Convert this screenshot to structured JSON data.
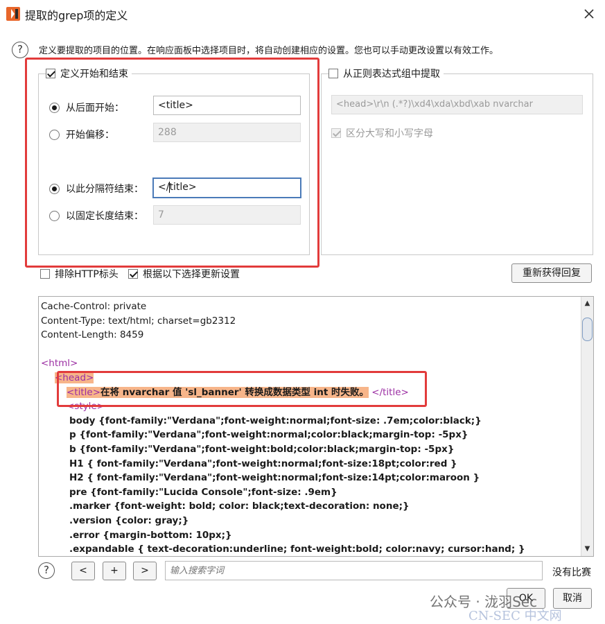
{
  "window": {
    "title": "提取的grep项的定义",
    "close_glyph": "✕"
  },
  "description": "定义要提取的项目的位置。在响应面板中选择项目时，将自动创建相应的设置。您也可以手动更改设置以有效工作。",
  "help_glyph": "?",
  "start_end_group": {
    "legend": "定义开始和结束",
    "checked": true,
    "start_after": {
      "label": "从后面开始：",
      "value": "<title>",
      "selected": true
    },
    "start_offset": {
      "label": "开始偏移：",
      "value": "288",
      "selected": false
    },
    "end_delimiter": {
      "label": "以此分隔符结束：",
      "value_before_caret": "</",
      "value_after_caret": "title>",
      "selected": true
    },
    "end_fixed_length": {
      "label": "以固定长度结束：",
      "value": "7",
      "selected": false
    }
  },
  "regex_group": {
    "legend": "从正则表达式组中提取",
    "checked": false,
    "expression": "<head>\\r\\n          (.*?)\\xd4\\xda\\xbd\\xab nvarchar",
    "case_sensitive_label": "区分大写和小写字母",
    "case_sensitive_checked": true
  },
  "options": {
    "exclude_http_headers": {
      "label": "排除HTTP标头",
      "checked": false
    },
    "update_from_selection": {
      "label": "根据以下选择更新设置",
      "checked": true
    },
    "refetch_button": "重新获得回复"
  },
  "response": {
    "headers": [
      "Cache-Control: private",
      "Content-Type: text/html; charset=gb2312",
      "Content-Length: 8459"
    ],
    "html_open": "<html>",
    "head_open": "<head>",
    "title_open": "<title>",
    "title_text": "在将 nvarchar 值 'sl_banner' 转换成数据类型 int 时失败。",
    "title_close": "</title>",
    "style_open": "<style>",
    "css_lines": [
      "body {font-family:\"Verdana\";font-weight:normal;font-size: .7em;color:black;}",
      "p {font-family:\"Verdana\";font-weight:normal;color:black;margin-top: -5px}",
      "b {font-family:\"Verdana\";font-weight:bold;color:black;margin-top: -5px}",
      "H1 { font-family:\"Verdana\";font-weight:normal;font-size:18pt;color:red }",
      "H2 { font-family:\"Verdana\";font-weight:normal;font-size:14pt;color:maroon }",
      "pre {font-family:\"Lucida Console\";font-size: .9em}",
      ".marker {font-weight: bold; color: black;text-decoration: none;}",
      ".version {color: gray;}",
      ".error {margin-bottom: 10px;}",
      ".expandable { text-decoration:underline; font-weight:bold; color:navy; cursor:hand; }"
    ],
    "scroll_up_glyph": "▲",
    "scroll_down_glyph": "▼"
  },
  "search": {
    "prev_label": "<",
    "add_label": "+",
    "next_label": ">",
    "placeholder": "输入搜索字词",
    "status": "没有比赛"
  },
  "footer": {
    "ok_label": "OK",
    "cancel_label": "取消"
  },
  "watermark": {
    "wechat": "公众号 · 泷羽Sec",
    "cnsec": "CN-SEC 中文网"
  },
  "colors": {
    "annotation_red": "#e23b3b",
    "tag_purple": "#9b2ea3",
    "highlight_orange": "#f7b58a",
    "app_icon_orange": "#e8662a"
  }
}
